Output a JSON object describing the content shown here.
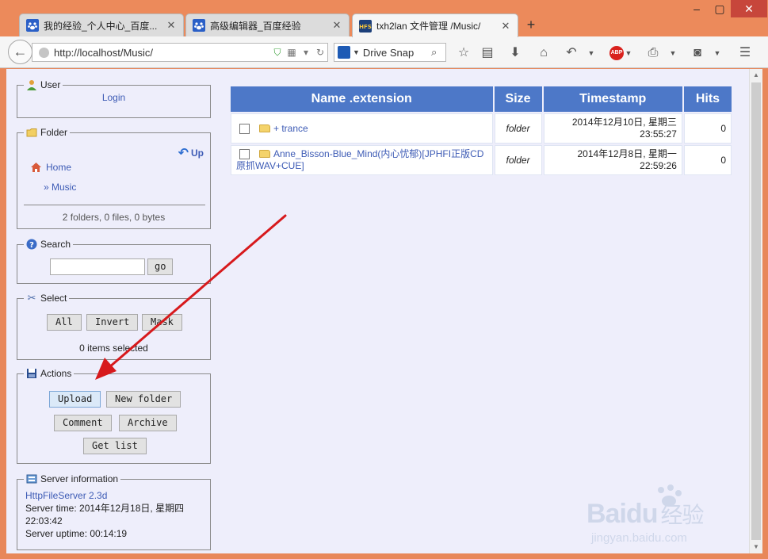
{
  "browser": {
    "tabs": [
      {
        "label": "我的经验_个人中心_百度..."
      },
      {
        "label": "高级编辑器_百度经验"
      },
      {
        "label": "txh2lan 文件管理 /Music/"
      }
    ],
    "url": "http://localhost/Music/",
    "search_engine": "Drive Snap"
  },
  "sidebar": {
    "user": {
      "legend": "User",
      "login": "Login"
    },
    "folder": {
      "legend": "Folder",
      "up": "Up",
      "home": "Home",
      "current": "» Music",
      "summary": "2 folders, 0 files, 0 bytes"
    },
    "search": {
      "legend": "Search",
      "go": "go"
    },
    "select": {
      "legend": "Select",
      "all": "All",
      "invert": "Invert",
      "mask": "Mask",
      "status": "0 items selected"
    },
    "actions": {
      "legend": "Actions",
      "upload": "Upload",
      "new_folder": "New folder",
      "comment": "Comment",
      "archive": "Archive",
      "get_list": "Get list"
    },
    "server": {
      "legend": "Server information",
      "name": "HttpFileServer 2.3d",
      "time_label": "Server time: 2014年12月18日, 星期四",
      "time_value": "22:03:42",
      "uptime": "Server uptime: 00:14:19"
    }
  },
  "table": {
    "headers": [
      "Name .extension",
      "Size",
      "Timestamp",
      "Hits"
    ],
    "rows": [
      {
        "name": "+ trance",
        "size": "folder",
        "date": "2014年12月10日, 星期三",
        "time": "23:55:27",
        "hits": "0"
      },
      {
        "name": "Anne_Bisson-Blue_Mind(内心忧郁)[JPHFI正版CD原抓WAV+CUE]",
        "size": "folder",
        "date": "2014年12月8日, 星期一",
        "time": "22:59:26",
        "hits": "0"
      }
    ]
  },
  "watermark": {
    "brand": "Bai",
    "suffix": "du",
    "product": "经验",
    "domain": "jingyan.baidu.com"
  },
  "colors": {
    "header_bg": "#4d78c8",
    "link": "#3d5bb5",
    "page_bg": "#eeeefb",
    "arrow": "#d7191c"
  }
}
